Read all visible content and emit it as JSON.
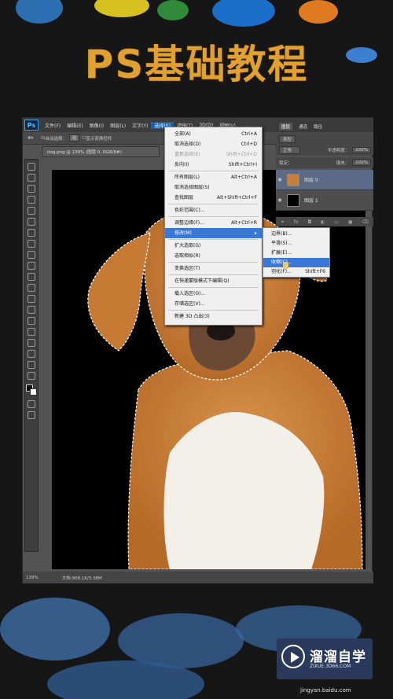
{
  "title": "PS基础教程",
  "ps": {
    "logo": "Ps",
    "menus": [
      "文件(F)",
      "编辑(E)",
      "图像(I)",
      "图层(L)",
      "文字(Y)",
      "选择(S)",
      "滤镜(T)",
      "3D(D)",
      "视图(V)"
    ],
    "active_menu": "选择(S)",
    "options": {
      "auto_select": "自动选择：",
      "auto_select_value": "组",
      "show_transform": "显示变换控件"
    },
    "doc_tab": "dog.png @ 139% (图层 0, RGB/8#)",
    "status": {
      "zoom": "139%",
      "doc": "文档:908.1K/3.38M"
    }
  },
  "layers_panel": {
    "tabs": [
      "图层",
      "通道",
      "路径"
    ],
    "active_tab": "图层",
    "kind": "类型",
    "blend_mode": "正常",
    "opacity_label": "不透明度：",
    "opacity": "100%",
    "lock_label": "锁定：",
    "fill_label": "填充：",
    "fill": "100%",
    "layers": [
      {
        "name": "图层 0",
        "selected": true
      },
      {
        "name": "图层 1",
        "selected": false
      }
    ]
  },
  "select_menu": [
    {
      "label": "全部(A)",
      "shortcut": "Ctrl+A"
    },
    {
      "label": "取消选择(D)",
      "shortcut": "Ctrl+D"
    },
    {
      "label": "重新选择(E)",
      "shortcut": "Shift+Ctrl+D",
      "disabled": true
    },
    {
      "label": "反向(I)",
      "shortcut": "Shift+Ctrl+I"
    },
    {
      "sep": true
    },
    {
      "label": "所有图层(L)",
      "shortcut": "Alt+Ctrl+A"
    },
    {
      "label": "取消选择图层(S)",
      "shortcut": ""
    },
    {
      "label": "查找图层",
      "shortcut": "Alt+Shift+Ctrl+F"
    },
    {
      "sep": true
    },
    {
      "label": "色彩范围(C)...",
      "shortcut": ""
    },
    {
      "sep": true
    },
    {
      "label": "调整边缘(F)...",
      "shortcut": "Alt+Ctrl+R"
    },
    {
      "label": "修改(M)",
      "shortcut": "▸",
      "highlight": true
    },
    {
      "sep": true
    },
    {
      "label": "扩大选取(G)",
      "shortcut": ""
    },
    {
      "label": "选取相似(R)",
      "shortcut": ""
    },
    {
      "sep": true
    },
    {
      "label": "变换选区(T)",
      "shortcut": ""
    },
    {
      "sep": true
    },
    {
      "label": "在快速蒙版模式下编辑(Q)",
      "shortcut": ""
    },
    {
      "sep": true
    },
    {
      "label": "载入选区(O)...",
      "shortcut": ""
    },
    {
      "label": "存储选区(V)...",
      "shortcut": ""
    },
    {
      "sep": true
    },
    {
      "label": "新建 3D 凸出(3)",
      "shortcut": ""
    }
  ],
  "modify_submenu": [
    {
      "label": "边界(B)...",
      "shortcut": ""
    },
    {
      "label": "平滑(S)...",
      "shortcut": ""
    },
    {
      "label": "扩展(E)...",
      "shortcut": ""
    },
    {
      "label": "收缩(C)...",
      "shortcut": "",
      "highlight": true
    },
    {
      "label": "羽化(F)...",
      "shortcut": "Shift+F6"
    }
  ],
  "watermark": {
    "name": "溜溜自学",
    "url": "ZIXUE.3D66.COM"
  },
  "footer": "jingyan.baidu.com"
}
